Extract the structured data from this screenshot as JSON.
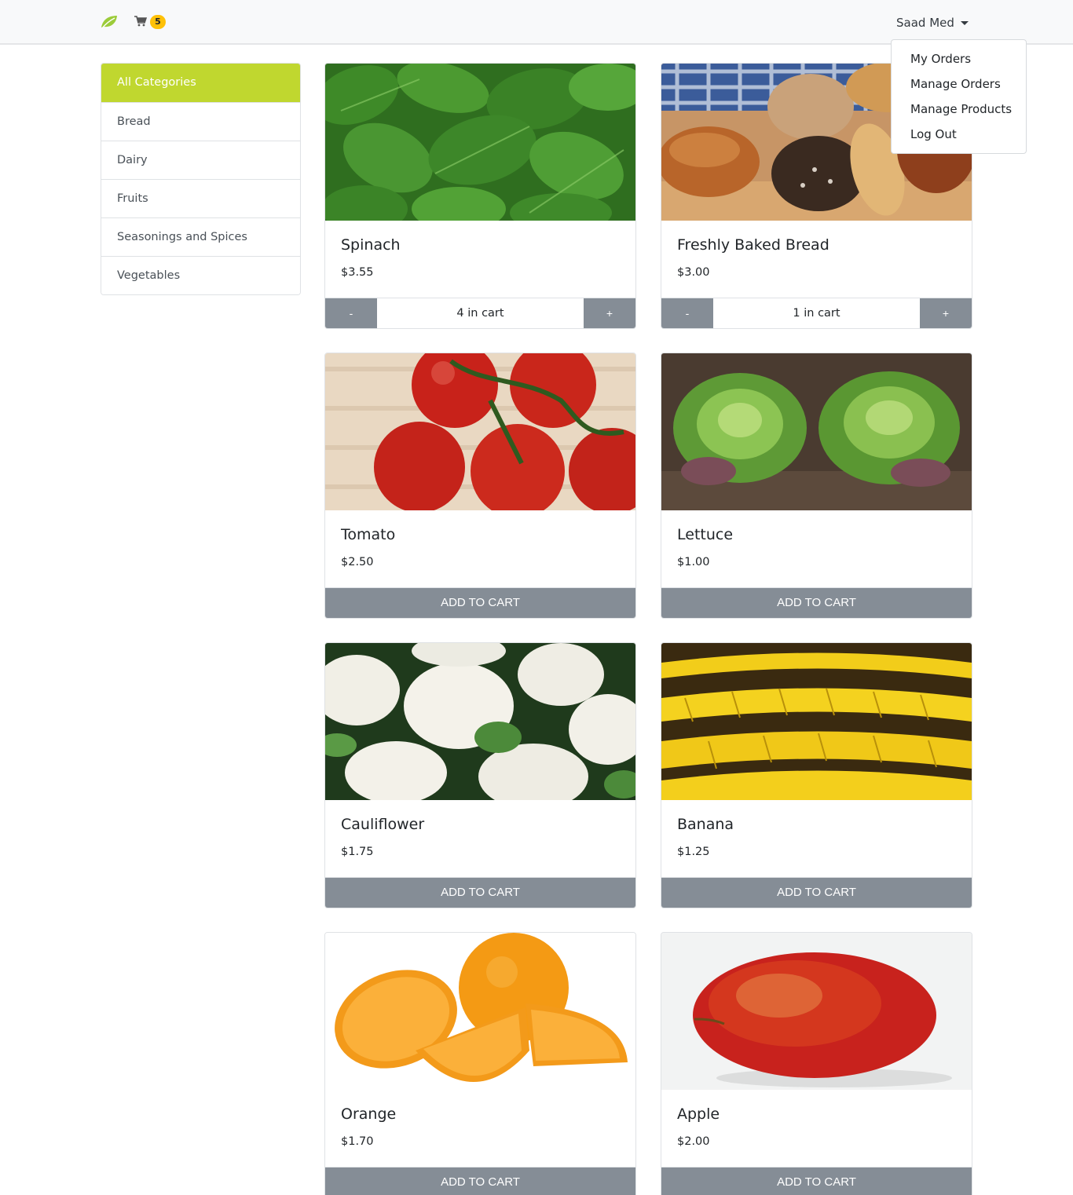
{
  "navbar": {
    "cart_count": "5",
    "user_name": "Saad Med"
  },
  "user_menu": {
    "items": [
      "My Orders",
      "Manage Orders",
      "Manage Products",
      "Log Out"
    ]
  },
  "categories": {
    "items": [
      "All Categories",
      "Bread",
      "Dairy",
      "Fruits",
      "Seasonings and Spices",
      "Vegetables"
    ],
    "active": "All Categories"
  },
  "products": [
    {
      "title": "Spinach",
      "price": "$3.55",
      "in_cart_label": "4 in cart",
      "minus": "-",
      "plus": "+"
    },
    {
      "title": "Freshly Baked Bread",
      "price": "$3.00",
      "in_cart_label": "1 in cart",
      "minus": "-",
      "plus": "+"
    },
    {
      "title": "Tomato",
      "price": "$2.50",
      "button": "ADD TO CART"
    },
    {
      "title": "Lettuce",
      "price": "$1.00",
      "button": "ADD TO CART"
    },
    {
      "title": "Cauliflower",
      "price": "$1.75",
      "button": "ADD TO CART"
    },
    {
      "title": "Banana",
      "price": "$1.25",
      "button": "ADD TO CART"
    },
    {
      "title": "Orange",
      "price": "$1.70",
      "button": "ADD TO CART"
    },
    {
      "title": "Apple",
      "price": "$2.00",
      "button": "ADD TO CART"
    }
  ],
  "colors": {
    "accent": "#c0d72f",
    "badge": "#ffc107",
    "button": "#858d96"
  }
}
